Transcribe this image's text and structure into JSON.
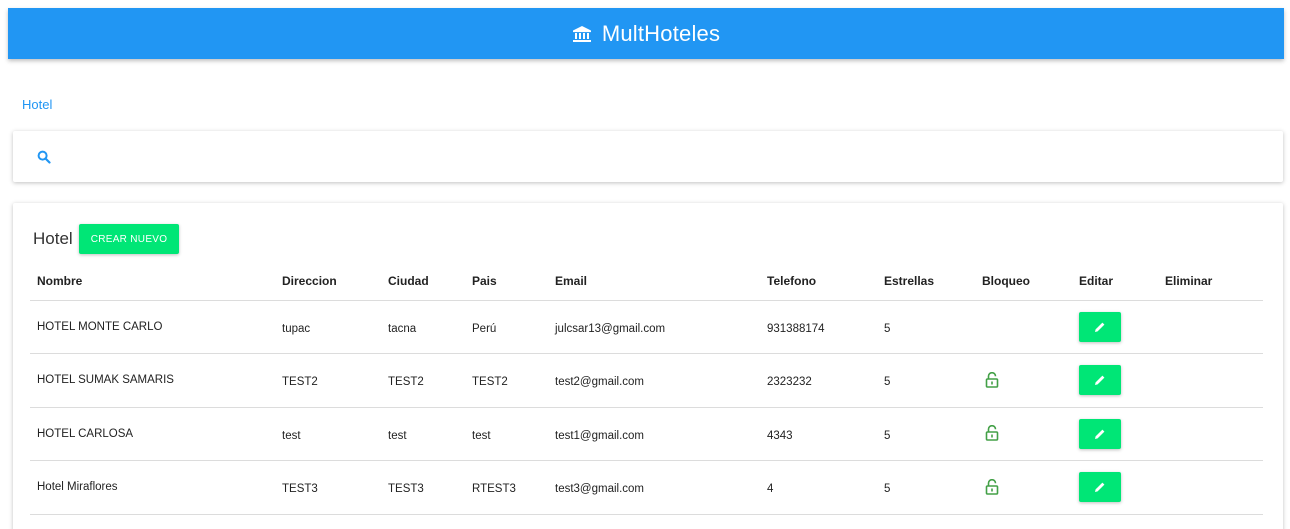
{
  "app": {
    "title": "MultHoteles",
    "icon": "bank-icon"
  },
  "breadcrumb": {
    "label": "Hotel"
  },
  "search": {
    "icon": "search-icon",
    "value": ""
  },
  "table_card": {
    "title": "Hotel",
    "create_button": "CREAR NUEVO",
    "columns": [
      "Nombre",
      "Direccion",
      "Ciudad",
      "Pais",
      "Email",
      "Telefono",
      "Estrellas",
      "Bloqueo",
      "Editar",
      "Eliminar"
    ],
    "rows": [
      {
        "nombre": "HOTEL MONTE CARLO",
        "direccion": "tupac",
        "ciudad": "tacna",
        "pais": "Perú",
        "email": "julcsar13@gmail.com",
        "telefono": "931388174",
        "estrellas": "5",
        "bloqueo": false
      },
      {
        "nombre": "HOTEL SUMAK SAMARIS",
        "direccion": "TEST2",
        "ciudad": "TEST2",
        "pais": "TEST2",
        "email": "test2@gmail.com",
        "telefono": "2323232",
        "estrellas": "5",
        "bloqueo": true
      },
      {
        "nombre": "HOTEL CARLOSA",
        "direccion": "test",
        "ciudad": "test",
        "pais": "test",
        "email": "test1@gmail.com",
        "telefono": "4343",
        "estrellas": "5",
        "bloqueo": true
      },
      {
        "nombre": "Hotel Miraflores",
        "direccion": "TEST3",
        "ciudad": "TEST3",
        "pais": "RTEST3",
        "email": "test3@gmail.com",
        "telefono": "4",
        "estrellas": "5",
        "bloqueo": true
      }
    ]
  },
  "colors": {
    "primary": "#2196f3",
    "accent": "#00e676",
    "lock": "#43a047"
  },
  "icons": {
    "lock": "lock-open-icon",
    "edit": "pencil-icon"
  }
}
